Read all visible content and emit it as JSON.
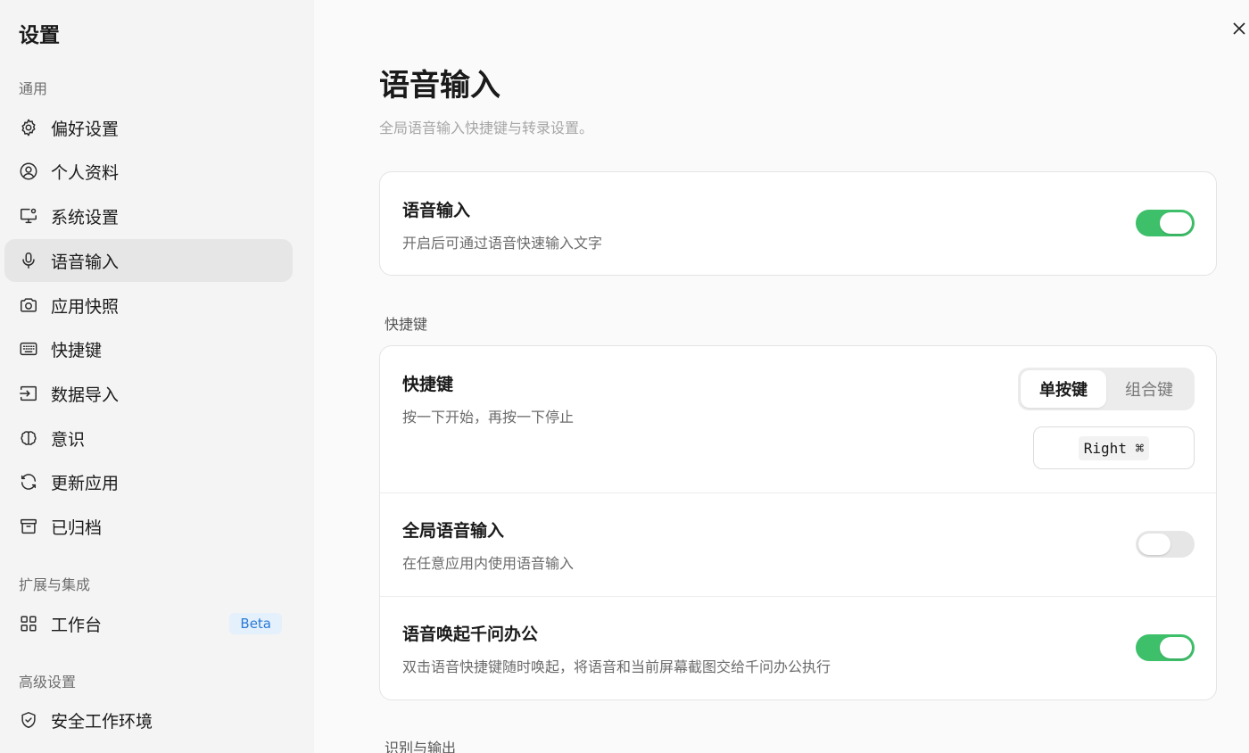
{
  "sidebar": {
    "title": "设置",
    "sections": {
      "general": "通用",
      "extensions": "扩展与集成",
      "advanced": "高级设置"
    },
    "items": [
      {
        "label": "偏好设置",
        "icon": "gear-icon"
      },
      {
        "label": "个人资料",
        "icon": "user-circle-icon"
      },
      {
        "label": "系统设置",
        "icon": "monitor-gear-icon"
      },
      {
        "label": "语音输入",
        "icon": "microphone-icon",
        "active": true
      },
      {
        "label": "应用快照",
        "icon": "camera-icon"
      },
      {
        "label": "快捷键",
        "icon": "keyboard-icon"
      },
      {
        "label": "数据导入",
        "icon": "import-icon"
      },
      {
        "label": "意识",
        "icon": "brain-icon"
      },
      {
        "label": "更新应用",
        "icon": "refresh-icon"
      },
      {
        "label": "已归档",
        "icon": "archive-icon"
      }
    ],
    "workspace": {
      "label": "工作台",
      "icon": "grid-icon",
      "badge": "Beta"
    },
    "secure_env": {
      "label": "安全工作环境",
      "icon": "shield-icon"
    }
  },
  "main": {
    "title": "语音输入",
    "subtitle": "全局语音输入快捷键与转录设置。",
    "voice_card": {
      "title": "语音输入",
      "desc": "开启后可通过语音快速输入文字",
      "enabled": true
    },
    "shortcut_section": {
      "label": "快捷键",
      "shortcut": {
        "title": "快捷键",
        "desc": "按一下开始，再按一下停止",
        "segments": [
          "单按键",
          "组合键"
        ],
        "selected_segment": "单按键",
        "key": "Right ⌘"
      },
      "global": {
        "title": "全局语音输入",
        "desc": "在任意应用内使用语音输入",
        "enabled": false
      },
      "wake": {
        "title": "语音唤起千问办公",
        "desc": "双击语音快捷键随时唤起，将语音和当前屏幕截图交给千问办公执行",
        "enabled": true
      }
    },
    "recognition_section": {
      "label": "识别与输出"
    }
  },
  "colors": {
    "accent_green": "#3ec06a",
    "beta_blue": "#2b7bd6"
  }
}
